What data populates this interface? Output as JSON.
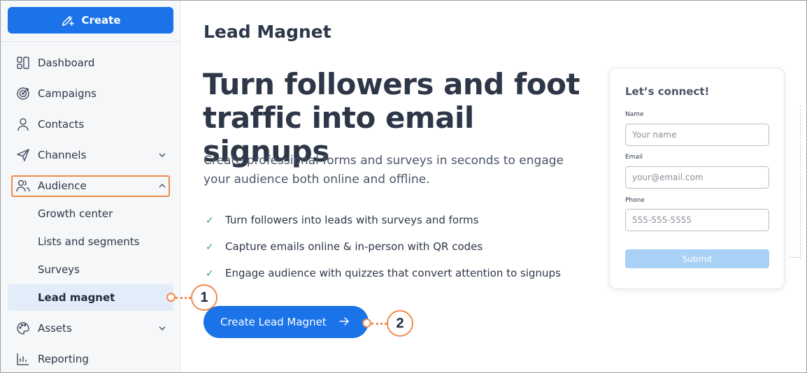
{
  "sidebar": {
    "create_label": "Create",
    "items": [
      {
        "label": "Dashboard",
        "icon": "dashboard-icon"
      },
      {
        "label": "Campaigns",
        "icon": "target-icon"
      },
      {
        "label": "Contacts",
        "icon": "person-icon"
      },
      {
        "label": "Channels",
        "icon": "send-icon"
      },
      {
        "label": "Audience",
        "icon": "people-icon"
      },
      {
        "label": "Assets",
        "icon": "palette-icon"
      },
      {
        "label": "Reporting",
        "icon": "chart-icon"
      }
    ],
    "audience_sub": [
      "Growth center",
      "Lists and segments",
      "Surveys",
      "Lead magnet"
    ]
  },
  "callouts": [
    "1",
    "2"
  ],
  "main": {
    "page_title": "Lead Magnet",
    "hero_line1": "Turn followers and foot",
    "hero_line2": "traffic into email signups",
    "description": "Create professional forms and surveys in seconds to engage your audience both online and offline.",
    "features": [
      "Turn followers into leads with surveys and forms",
      "Capture emails online & in-person with QR codes",
      "Engage audience with quizzes that convert attention to signups"
    ],
    "cta_label": "Create Lead Magnet"
  },
  "form_preview": {
    "title": "Let’s connect!",
    "name_label": "Name",
    "name_placeholder": "Your name",
    "email_label": "Email",
    "email_placeholder": "your@email.com",
    "phone_label": "Phone",
    "phone_placeholder": "555-555-5555",
    "submit_label": "Submit"
  },
  "colors": {
    "accent": "#1a73e8",
    "callout": "#f08a4b",
    "active_bg": "#e3edf9"
  }
}
